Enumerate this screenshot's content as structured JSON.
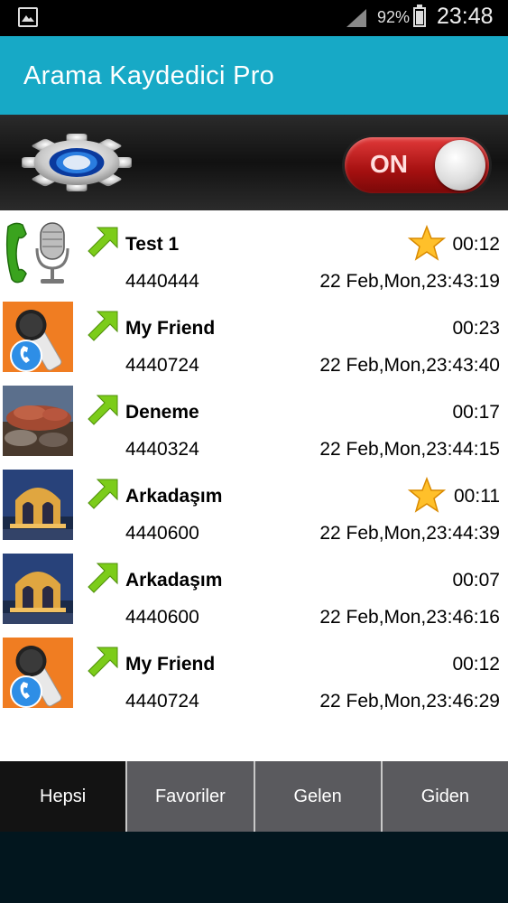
{
  "status_bar": {
    "battery_percent": "92%",
    "time": "23:48",
    "icons": [
      "gallery-icon",
      "signal-icon",
      "battery-icon"
    ]
  },
  "app_bar": {
    "title": "Arama Kaydedici Pro"
  },
  "toolbar": {
    "settings_icon": "gear-icon",
    "toggle_label": "ON",
    "toggle_state": "on"
  },
  "recordings": [
    {
      "name": "Test 1",
      "number": "4440444",
      "duration": "00:12",
      "datetime": "22 Feb,Mon,23:43:19",
      "favorite": true,
      "direction": "outgoing",
      "thumb": "phone-mic"
    },
    {
      "name": "My Friend",
      "number": "4440724",
      "duration": "00:23",
      "datetime": "22 Feb,Mon,23:43:40",
      "favorite": false,
      "direction": "outgoing",
      "thumb": "mic-orange"
    },
    {
      "name": "Deneme",
      "number": "4440324",
      "duration": "00:17",
      "datetime": "22 Feb,Mon,23:44:15",
      "favorite": false,
      "direction": "outgoing",
      "thumb": "photo-food"
    },
    {
      "name": "Arkadaşım",
      "number": "4440600",
      "duration": "00:11",
      "datetime": "22 Feb,Mon,23:44:39",
      "favorite": true,
      "direction": "outgoing",
      "thumb": "photo-palace"
    },
    {
      "name": "Arkadaşım",
      "number": "4440600",
      "duration": "00:07",
      "datetime": "22 Feb,Mon,23:46:16",
      "favorite": false,
      "direction": "outgoing",
      "thumb": "photo-palace"
    },
    {
      "name": "My Friend",
      "number": "4440724",
      "duration": "00:12",
      "datetime": "22 Feb,Mon,23:46:29",
      "favorite": false,
      "direction": "outgoing",
      "thumb": "mic-orange"
    }
  ],
  "tabs": [
    {
      "label": "Hepsi",
      "active": true
    },
    {
      "label": "Favoriler",
      "active": false
    },
    {
      "label": "Gelen",
      "active": false
    },
    {
      "label": "Giden",
      "active": false
    }
  ],
  "colors": {
    "app_bar": "#17a9c6",
    "toggle_on": "#c62020",
    "arrow": "#7ccc1a",
    "tab_active": "#131313",
    "tab_inactive": "#5a5a5e"
  }
}
